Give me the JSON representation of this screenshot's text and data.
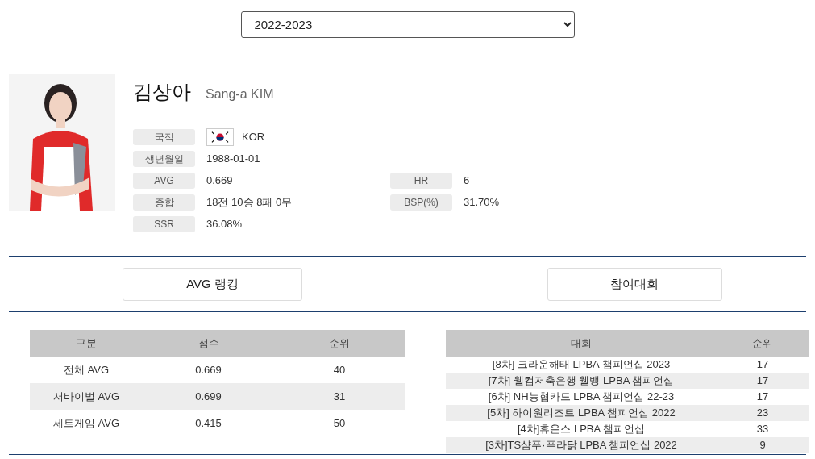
{
  "season_select": {
    "value": "2022-2023"
  },
  "player": {
    "name_ko": "김상아",
    "name_en": "Sang-a KIM",
    "info": [
      {
        "label": "국적",
        "value": "KOR",
        "kind": "flag"
      },
      {
        "label": "생년월일",
        "value": "1988-01-01",
        "kind": "text"
      },
      {
        "label": "AVG",
        "value": "0.669",
        "kind": "text",
        "label2": "HR",
        "value2": "6"
      },
      {
        "label": "종합",
        "value": "18전 10승 8패 0무",
        "kind": "text",
        "label2": "BSP(%)",
        "value2": "31.70%"
      },
      {
        "label": "SSR",
        "value": "36.08%",
        "kind": "text"
      }
    ]
  },
  "section_buttons": [
    "AVG 랭킹",
    "참여대회"
  ],
  "avg_table": {
    "columns": [
      "구분",
      "점수",
      "순위"
    ],
    "rows": [
      [
        "전체 AVG",
        "0.669",
        "40"
      ],
      [
        "서바이벌 AVG",
        "0.699",
        "31"
      ],
      [
        "세트게임 AVG",
        "0.415",
        "50"
      ]
    ]
  },
  "tournament_table": {
    "columns": [
      "대회",
      "순위"
    ],
    "rows": [
      {
        "name": "[8차] 크라운해태 LPBA 챔피언십 2023",
        "rank": "17"
      },
      {
        "name": "[7차] 웰컴저축은행 웰뱅 LPBA 챔피언십",
        "rank": "17"
      },
      {
        "name": "[6차] NH농협카드 LPBA 챔피언십 22-23",
        "rank": "17"
      },
      {
        "name": "[5차] 하이원리조트 LPBA 챔피언십 2022",
        "rank": "23"
      },
      {
        "name": "[4차]휴온스 LPBA 챔피언십",
        "rank": "33"
      },
      {
        "name": "[3차]TS샴푸·푸라닭 LPBA 챔피언십 2022",
        "rank": "9"
      }
    ]
  }
}
